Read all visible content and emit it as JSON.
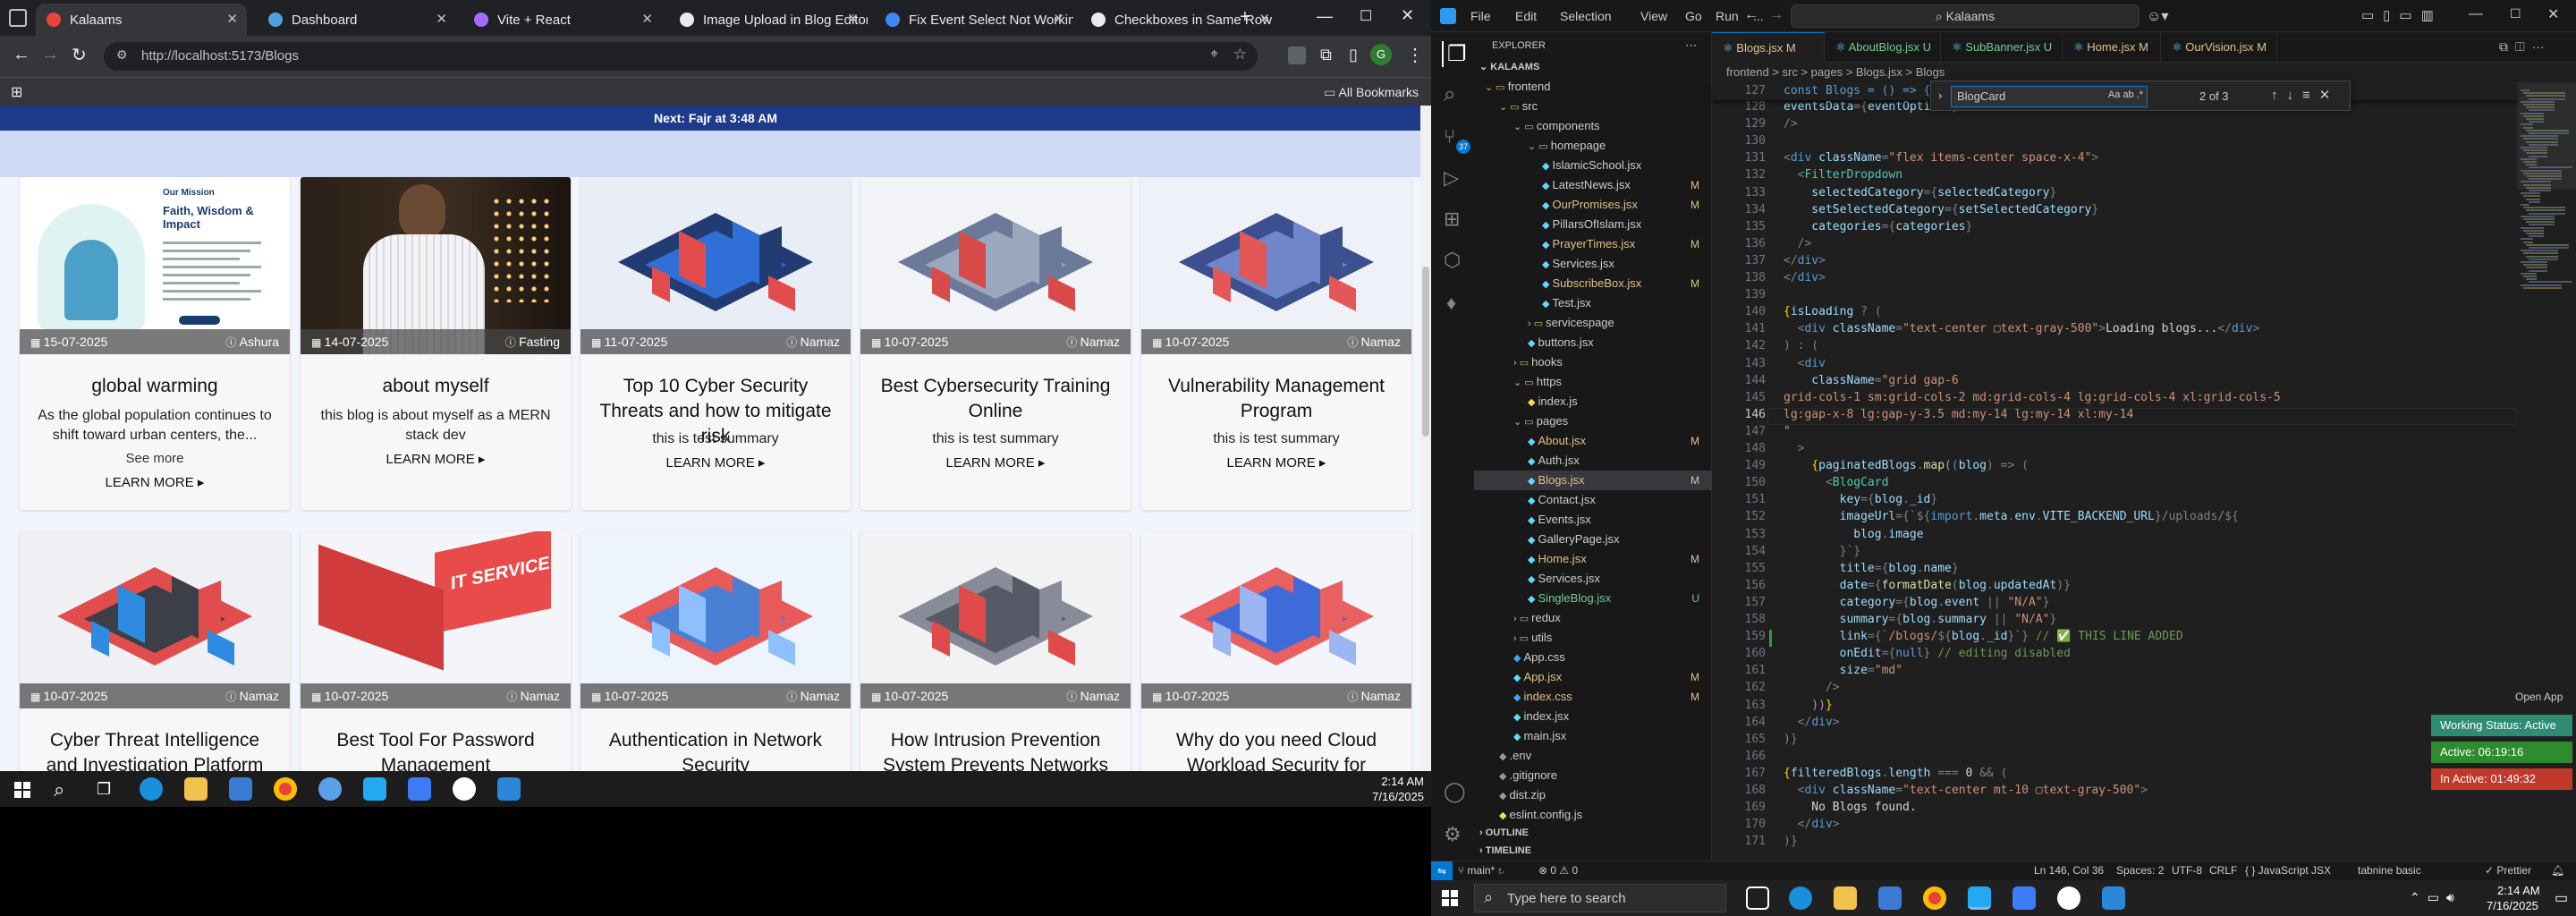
{
  "browser": {
    "tabs": [
      {
        "label": "Kalaams",
        "active": true,
        "color": "#e8453c"
      },
      {
        "label": "Dashboard",
        "active": false,
        "color": "#4aa3df"
      },
      {
        "label": "Vite + React",
        "active": false,
        "color": "#a36bff"
      },
      {
        "label": "Image Upload in Blog Editor",
        "active": false,
        "color": "#e8eaed"
      },
      {
        "label": "Fix Event Select Not Working",
        "active": false,
        "color": "#4285f4"
      },
      {
        "label": "Checkboxes in Same Row",
        "active": false,
        "color": "#e8eaed"
      }
    ],
    "url": "http://localhost:5173/Blogs",
    "all_bookmarks": "All Bookmarks",
    "profile_initial": "G"
  },
  "site": {
    "prayer_notice": "Next: Fajr at 3:48 AM",
    "cards": [
      {
        "date": "15-07-2025",
        "category": "Ashura",
        "title": "global warming",
        "summary": "As the global population continues to shift toward urban centers, the...",
        "see_more": "See more",
        "learn_more": "LEARN MORE ▸",
        "img": "mission",
        "mission": {
          "heading": "Our Mission",
          "title": "Faith, Wisdom & Impact"
        }
      },
      {
        "date": "14-07-2025",
        "category": "Fasting",
        "title": "about myself",
        "summary": "this blog is about myself as a MERN stack dev",
        "learn_more": "LEARN MORE ▸",
        "img": "person"
      },
      {
        "date": "11-07-2025",
        "category": "Namaz",
        "title": "Top 10 Cyber Security Threats and how to mitigate risk",
        "summary": "this is test summary",
        "learn_more": "LEARN MORE ▸",
        "img": "iso-blue"
      },
      {
        "date": "10-07-2025",
        "category": "Namaz",
        "title": "Best Cybersecurity Training Online",
        "summary": "this is test summary",
        "learn_more": "LEARN MORE ▸",
        "img": "iso-factory"
      },
      {
        "date": "10-07-2025",
        "category": "Namaz",
        "title": "Vulnerability Management Program",
        "summary": "this is test summary",
        "learn_more": "LEARN MORE ▸",
        "img": "iso-city"
      },
      {
        "date": "10-07-2025",
        "category": "Namaz",
        "title": "Cyber Threat Intelligence and Investigation Platform",
        "img": "iso-server"
      },
      {
        "date": "10-07-2025",
        "category": "Namaz",
        "title": "Best Tool For Password Management",
        "img": "it-service"
      },
      {
        "date": "10-07-2025",
        "category": "Namaz",
        "title": "Authentication in Network Security",
        "img": "iso-auth"
      },
      {
        "date": "10-07-2025",
        "category": "Namaz",
        "title": "How Intrusion Prevention System Prevents Networks",
        "img": "iso-db"
      },
      {
        "date": "10-07-2025",
        "category": "Namaz",
        "title": "Why do you need Cloud Workload Security for",
        "img": "iso-cloud"
      }
    ],
    "it_service_label": "IT SERVICE"
  },
  "vscode": {
    "menu": [
      "File",
      "Edit",
      "Selection",
      "View",
      "Go",
      "Run",
      "..."
    ],
    "search": "Kalaams",
    "explorer_title": "EXPLORER",
    "workspace": "KALAAMS",
    "tree": [
      {
        "label": "frontend",
        "kind": "folder-open",
        "depth": 0
      },
      {
        "label": "src",
        "kind": "folder-open",
        "depth": 1
      },
      {
        "label": "components",
        "kind": "folder-open",
        "depth": 2
      },
      {
        "label": "homepage",
        "kind": "folder-open",
        "depth": 3
      },
      {
        "label": "IslamicSchool.jsx",
        "kind": "file",
        "depth": 4
      },
      {
        "label": "LatestNews.jsx",
        "kind": "file",
        "depth": 4,
        "badge": "M"
      },
      {
        "label": "OurPromises.jsx",
        "kind": "file",
        "depth": 4,
        "badge": "M",
        "mod": true
      },
      {
        "label": "PillarsOfIslam.jsx",
        "kind": "file",
        "depth": 4
      },
      {
        "label": "PrayerTimes.jsx",
        "kind": "file",
        "depth": 4,
        "badge": "M",
        "mod": true
      },
      {
        "label": "Services.jsx",
        "kind": "file",
        "depth": 4
      },
      {
        "label": "SubscribeBox.jsx",
        "kind": "file",
        "depth": 4,
        "badge": "M",
        "mod": true
      },
      {
        "label": "Test.jsx",
        "kind": "file",
        "depth": 4
      },
      {
        "label": "servicespage",
        "kind": "folder",
        "depth": 3
      },
      {
        "label": "buttons.jsx",
        "kind": "file",
        "depth": 3
      },
      {
        "label": "hooks",
        "kind": "folder",
        "depth": 2
      },
      {
        "label": "https",
        "kind": "folder-open",
        "depth": 2
      },
      {
        "label": "index.js",
        "kind": "file",
        "depth": 3
      },
      {
        "label": "pages",
        "kind": "folder-open",
        "depth": 2
      },
      {
        "label": "About.jsx",
        "kind": "file",
        "depth": 3,
        "badge": "M",
        "mod": true
      },
      {
        "label": "Auth.jsx",
        "kind": "file",
        "depth": 3
      },
      {
        "label": "Blogs.jsx",
        "kind": "file",
        "depth": 3,
        "badge": "M",
        "mod": true,
        "selected": true
      },
      {
        "label": "Contact.jsx",
        "kind": "file",
        "depth": 3
      },
      {
        "label": "Events.jsx",
        "kind": "file",
        "depth": 3
      },
      {
        "label": "GalleryPage.jsx",
        "kind": "file",
        "depth": 3
      },
      {
        "label": "Home.jsx",
        "kind": "file",
        "depth": 3,
        "badge": "M",
        "mod": true
      },
      {
        "label": "Services.jsx",
        "kind": "file",
        "depth": 3
      },
      {
        "label": "SingleBlog.jsx",
        "kind": "file",
        "depth": 3,
        "badge": "U",
        "new": true
      },
      {
        "label": "redux",
        "kind": "folder",
        "depth": 2
      },
      {
        "label": "utils",
        "kind": "folder",
        "depth": 2
      },
      {
        "label": "App.css",
        "kind": "file",
        "depth": 2
      },
      {
        "label": "App.jsx",
        "kind": "file",
        "depth": 2,
        "badge": "M",
        "mod": true
      },
      {
        "label": "index.css",
        "kind": "file",
        "depth": 2,
        "badge": "M",
        "mod": true
      },
      {
        "label": "index.jsx",
        "kind": "file",
        "depth": 2
      },
      {
        "label": "main.jsx",
        "kind": "file",
        "depth": 2
      },
      {
        "label": ".env",
        "kind": "file",
        "depth": 1
      },
      {
        "label": ".gitignore",
        "kind": "file",
        "depth": 1
      },
      {
        "label": "dist.zip",
        "kind": "file",
        "depth": 1
      },
      {
        "label": "eslint.config.js",
        "kind": "file",
        "depth": 1
      }
    ],
    "outline": "OUTLINE",
    "timeline": "TIMELINE",
    "editor_tabs": [
      {
        "label": "Blogs.jsx M",
        "active": true
      },
      {
        "label": "AboutBlog.jsx U",
        "active": false
      },
      {
        "label": "SubBanner.jsx U",
        "active": false
      },
      {
        "label": "Home.jsx M",
        "active": false
      },
      {
        "label": "OurVision.jsx M",
        "active": false
      }
    ],
    "breadcrumb": "frontend > src > pages > Blogs.jsx > Blogs",
    "sticky": "const Blogs = () => {",
    "find_value": "BlogCard",
    "find_count": "2 of 3",
    "code_start": 128,
    "code": [
      [
        [
          "a",
          "eventsData"
        ],
        [
          "p",
          "={"
        ],
        [
          "a",
          "eventOptions"
        ],
        [
          "p",
          "}"
        ]
      ],
      [
        [
          "p",
          "/>"
        ]
      ],
      [],
      [
        [
          "p",
          "<"
        ],
        [
          "k",
          "div "
        ],
        [
          "a",
          "className"
        ],
        [
          "p",
          "="
        ],
        [
          "s",
          "\"flex items-center space-x-4\""
        ],
        [
          "p",
          ">"
        ]
      ],
      [
        [
          "p",
          "  <"
        ],
        [
          "t",
          "FilterDropdown"
        ]
      ],
      [
        [
          "a",
          "    selectedCategory"
        ],
        [
          "p",
          "={"
        ],
        [
          "a",
          "selectedCategory"
        ],
        [
          "p",
          "}"
        ]
      ],
      [
        [
          "a",
          "    setSelectedCategory"
        ],
        [
          "p",
          "={"
        ],
        [
          "a",
          "setSelectedCategory"
        ],
        [
          "p",
          "}"
        ]
      ],
      [
        [
          "a",
          "    categories"
        ],
        [
          "p",
          "={"
        ],
        [
          "a",
          "categories"
        ],
        [
          "p",
          "}"
        ]
      ],
      [
        [
          "p",
          "  />"
        ]
      ],
      [
        [
          "p",
          "</"
        ],
        [
          "k",
          "div"
        ],
        [
          "p",
          ">"
        ]
      ],
      [
        [
          "p",
          "</"
        ],
        [
          "k",
          "div"
        ],
        [
          "p",
          ">"
        ]
      ],
      [],
      [
        [
          "b",
          "{"
        ],
        [
          "a",
          "isLoading"
        ],
        [
          "p",
          " ? ("
        ]
      ],
      [
        [
          "p",
          "  <"
        ],
        [
          "k",
          "div "
        ],
        [
          "a",
          "className"
        ],
        [
          "p",
          "="
        ],
        [
          "s",
          "\"text-center ▢text-gray-500\""
        ],
        [
          "p",
          ">"
        ],
        [
          "x",
          "Loading blogs..."
        ],
        [
          "p",
          "</"
        ],
        [
          "k",
          "div"
        ],
        [
          "p",
          ">"
        ]
      ],
      [
        [
          "p",
          ") : ("
        ]
      ],
      [
        [
          "p",
          "  <"
        ],
        [
          "k",
          "div"
        ]
      ],
      [
        [
          "a",
          "    className"
        ],
        [
          "p",
          "="
        ],
        [
          "s",
          "\"grid gap-6"
        ]
      ],
      [
        [
          "s",
          "grid-cols-1 sm:grid-cols-2 md:grid-cols-4 lg:grid-cols-4 xl:grid-cols-5"
        ]
      ],
      [
        [
          "s",
          "lg:gap-x-8 lg:gap-y-3.5 md:my-14 lg:my-14 xl:my-14"
        ]
      ],
      [
        [
          "s",
          "\""
        ]
      ],
      [
        [
          "p",
          "  >"
        ]
      ],
      [
        [
          "b",
          "    {"
        ],
        [
          "a",
          "paginatedBlogs"
        ],
        [
          "p",
          "."
        ],
        [
          "f",
          "map"
        ],
        [
          "m",
          "("
        ],
        [
          "p",
          "("
        ],
        [
          "a",
          "blog"
        ],
        [
          "p",
          ") => ("
        ]
      ],
      [
        [
          "p",
          "      <"
        ],
        [
          "t",
          "BlogCard"
        ]
      ],
      [
        [
          "a",
          "        key"
        ],
        [
          "p",
          "={"
        ],
        [
          "a",
          "blog"
        ],
        [
          "p",
          "."
        ],
        [
          "a",
          "_id"
        ],
        [
          "p",
          "}"
        ]
      ],
      [
        [
          "a",
          "        imageUrl"
        ],
        [
          "p",
          "={`${"
        ],
        [
          "k",
          "import"
        ],
        [
          "p",
          "."
        ],
        [
          "a",
          "meta"
        ],
        [
          "p",
          "."
        ],
        [
          "a",
          "env"
        ],
        [
          "p",
          "."
        ],
        [
          "a",
          "VITE_BACKEND_URL"
        ],
        [
          "p",
          "}/uploads/${"
        ]
      ],
      [
        [
          "a",
          "          blog"
        ],
        [
          "p",
          "."
        ],
        [
          "a",
          "image"
        ]
      ],
      [
        [
          "p",
          "        }`}"
        ]
      ],
      [
        [
          "a",
          "        title"
        ],
        [
          "p",
          "={"
        ],
        [
          "a",
          "blog"
        ],
        [
          "p",
          "."
        ],
        [
          "a",
          "name"
        ],
        [
          "p",
          "}"
        ]
      ],
      [
        [
          "a",
          "        date"
        ],
        [
          "p",
          "={"
        ],
        [
          "f",
          "formatDate"
        ],
        [
          "p",
          "("
        ],
        [
          "a",
          "blog"
        ],
        [
          "p",
          "."
        ],
        [
          "a",
          "updatedAt"
        ],
        [
          "p",
          ")}"
        ]
      ],
      [
        [
          "a",
          "        category"
        ],
        [
          "p",
          "={"
        ],
        [
          "a",
          "blog"
        ],
        [
          "p",
          "."
        ],
        [
          "a",
          "event"
        ],
        [
          "p",
          " || "
        ],
        [
          "s",
          "\"N/A\""
        ],
        [
          "p",
          "}"
        ]
      ],
      [
        [
          "a",
          "        summary"
        ],
        [
          "p",
          "={"
        ],
        [
          "a",
          "blog"
        ],
        [
          "p",
          "."
        ],
        [
          "a",
          "summary"
        ],
        [
          "p",
          " || "
        ],
        [
          "s",
          "\"N/A\""
        ],
        [
          "p",
          "}"
        ]
      ],
      [
        [
          "a",
          "        link"
        ],
        [
          "p",
          "={`"
        ],
        [
          "s",
          "/blogs/"
        ],
        [
          "p",
          "${"
        ],
        [
          "a",
          "blog"
        ],
        [
          "p",
          "."
        ],
        [
          "a",
          "_id"
        ],
        [
          "p",
          "}`} "
        ],
        [
          "g",
          "// ✅ THIS LINE ADDED"
        ]
      ],
      [
        [
          "a",
          "        onEdit"
        ],
        [
          "p",
          "={"
        ],
        [
          "k",
          "null"
        ],
        [
          "p",
          "} "
        ],
        [
          "g",
          "// editing disabled"
        ]
      ],
      [
        [
          "a",
          "        size"
        ],
        [
          "p",
          "="
        ],
        [
          "s",
          "\"md\""
        ]
      ],
      [
        [
          "p",
          "      />"
        ]
      ],
      [
        [
          "m",
          "    ))"
        ],
        [
          "b",
          "}"
        ]
      ],
      [
        [
          "p",
          "  </"
        ],
        [
          "k",
          "div"
        ],
        [
          "p",
          ">"
        ]
      ],
      [
        [
          "p",
          ")}"
        ]
      ],
      [],
      [
        [
          "b",
          "{"
        ],
        [
          "a",
          "filteredBlogs"
        ],
        [
          "p",
          "."
        ],
        [
          "a",
          "length"
        ],
        [
          "p",
          " === "
        ],
        [
          "x",
          "0"
        ],
        [
          "p",
          " && ("
        ]
      ],
      [
        [
          "p",
          "  <"
        ],
        [
          "k",
          "div "
        ],
        [
          "a",
          "className"
        ],
        [
          "p",
          "="
        ],
        [
          "s",
          "\"text-center mt-10 ▢text-gray-500\""
        ],
        [
          "p",
          ">"
        ]
      ],
      [
        [
          "x",
          "    No Blogs found."
        ]
      ],
      [
        [
          "p",
          "  </"
        ],
        [
          "k",
          "div"
        ],
        [
          "p",
          ">"
        ]
      ],
      [
        [
          "p",
          ")}"
        ]
      ]
    ],
    "status": {
      "branch": "main*",
      "errors": "⊗ 0 ⚠ 0",
      "position": "Ln 146, Col 36",
      "spaces": "Spaces: 2",
      "encoding": "UTF-8",
      "eol": "CRLF",
      "language": "{ } JavaScript JSX",
      "tabnine": "tabnine basic",
      "prettier": "✓ Prettier"
    },
    "open_app": "Open App",
    "working_status": "Working Status: Active",
    "active_time": "Active: 06:19:16",
    "inactive_time": "In Active: 01:49:32"
  },
  "taskbar": {
    "time": "2:14 AM",
    "date": "7/16/2025",
    "search_placeholder": "Type here to search"
  }
}
